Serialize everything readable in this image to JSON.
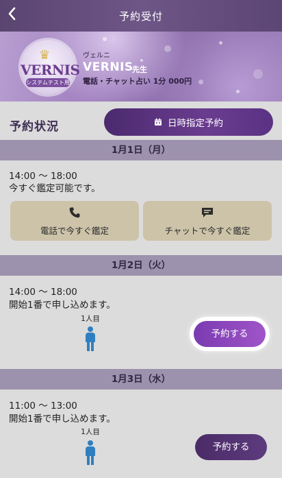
{
  "header": {
    "title": "予約受付",
    "back_icon": "chevron-left-icon"
  },
  "teacher": {
    "logo_text": "VERNIS",
    "logo_sub": "システムテスト用",
    "kana": "ヴェルニ",
    "name": "VERNIS",
    "suffix": "先生",
    "price": "電話・チャット占い 1分 000円"
  },
  "status": {
    "title": "予約状況",
    "date_button_label": "日時指定予約",
    "date_button_icon": "calendar-icon"
  },
  "days": [
    {
      "date": "1月1日（月）",
      "time": "14:00 〜 18:00",
      "note": "今すぐ鑑定可能です。",
      "buttons": [
        {
          "icon": "phone-icon",
          "label": "電話で今すぐ鑑定"
        },
        {
          "icon": "chat-icon",
          "label": "チャットで今すぐ鑑定"
        }
      ]
    },
    {
      "date": "1月2日（火）",
      "time": "14:00 〜 18:00",
      "note": "開始1番で申し込めます。",
      "slot_label": "1人目",
      "reserve_label": "予約する"
    },
    {
      "date": "1月3日（水）",
      "time": "11:00 〜 13:00",
      "note": "開始1番で申し込めます。",
      "slot_label": "1人目",
      "reserve_label": "予約する"
    }
  ],
  "colors": {
    "accent": "#6a3c8f",
    "highlight_button": "#9b4fc4",
    "person_icon": "#2f7fc0",
    "consult_button": "#ccc3a9",
    "day_header": "#9d92ad"
  }
}
